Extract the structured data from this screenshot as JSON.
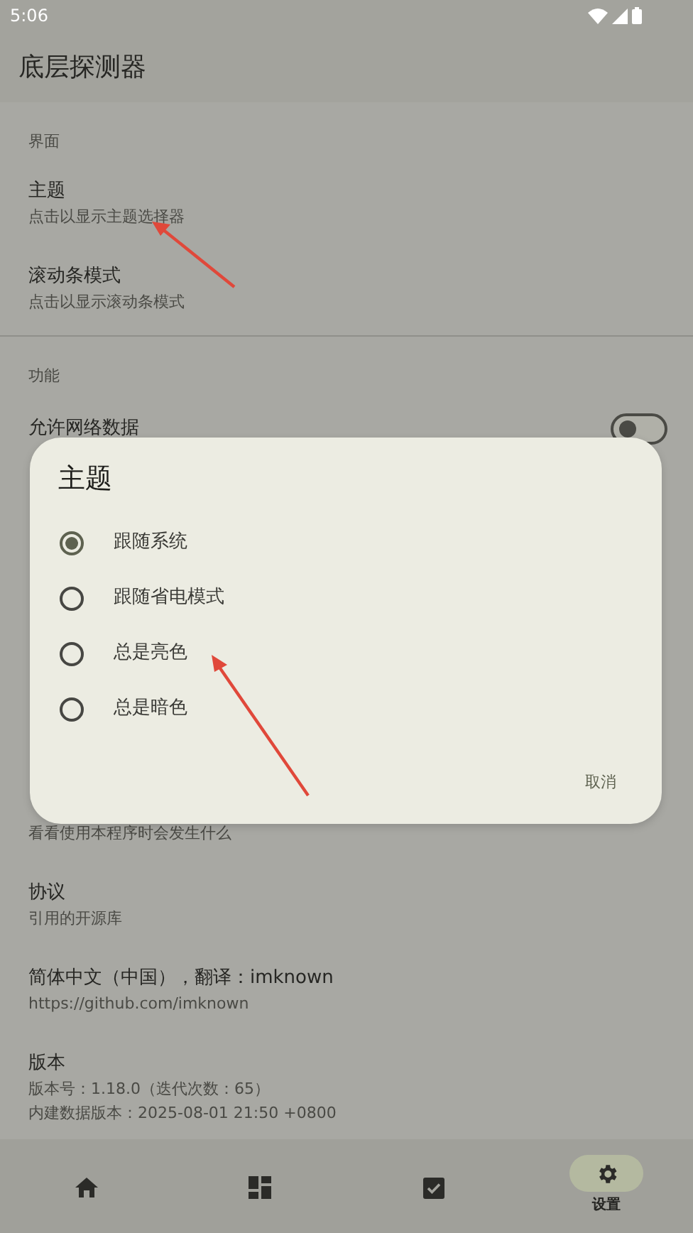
{
  "status_bar": {
    "time": "5:06"
  },
  "app_bar": {
    "title": "底层探测器"
  },
  "sections": [
    {
      "header": "界面",
      "items": [
        {
          "kind": "text",
          "title": "主题",
          "subtitle": "点击以显示主题选择器"
        },
        {
          "kind": "text",
          "title": "滚动条模式",
          "subtitle": "点击以显示滚动条模式"
        }
      ]
    },
    {
      "header": "功能",
      "items": [
        {
          "kind": "switch",
          "title": "允许网络数据",
          "on": false
        }
      ]
    }
  ],
  "items_below_dialog": [
    {
      "lines": [
        "看看使用本程序时会发生什么"
      ]
    },
    {
      "title": "协议",
      "lines": [
        "引用的开源库"
      ]
    },
    {
      "title": "简体中文（中国），翻译：imknown",
      "lines": [
        "https://github.com/imknown"
      ]
    },
    {
      "title": "版本",
      "lines": [
        "版本号：1.18.0（迭代次数：65）",
        "内建数据版本：2025-08-01 21:50 +0800"
      ]
    }
  ],
  "dialog": {
    "title": "主题",
    "options": [
      {
        "label": "跟随系统",
        "selected": true
      },
      {
        "label": "跟随省电模式",
        "selected": false
      },
      {
        "label": "总是亮色",
        "selected": false
      },
      {
        "label": "总是暗色",
        "selected": false
      }
    ],
    "buttons": [
      "取消"
    ]
  },
  "bottom_nav": [
    {
      "selected": false
    },
    {
      "selected": false
    },
    {
      "selected": false
    },
    {
      "label": "设置",
      "selected": true
    }
  ]
}
